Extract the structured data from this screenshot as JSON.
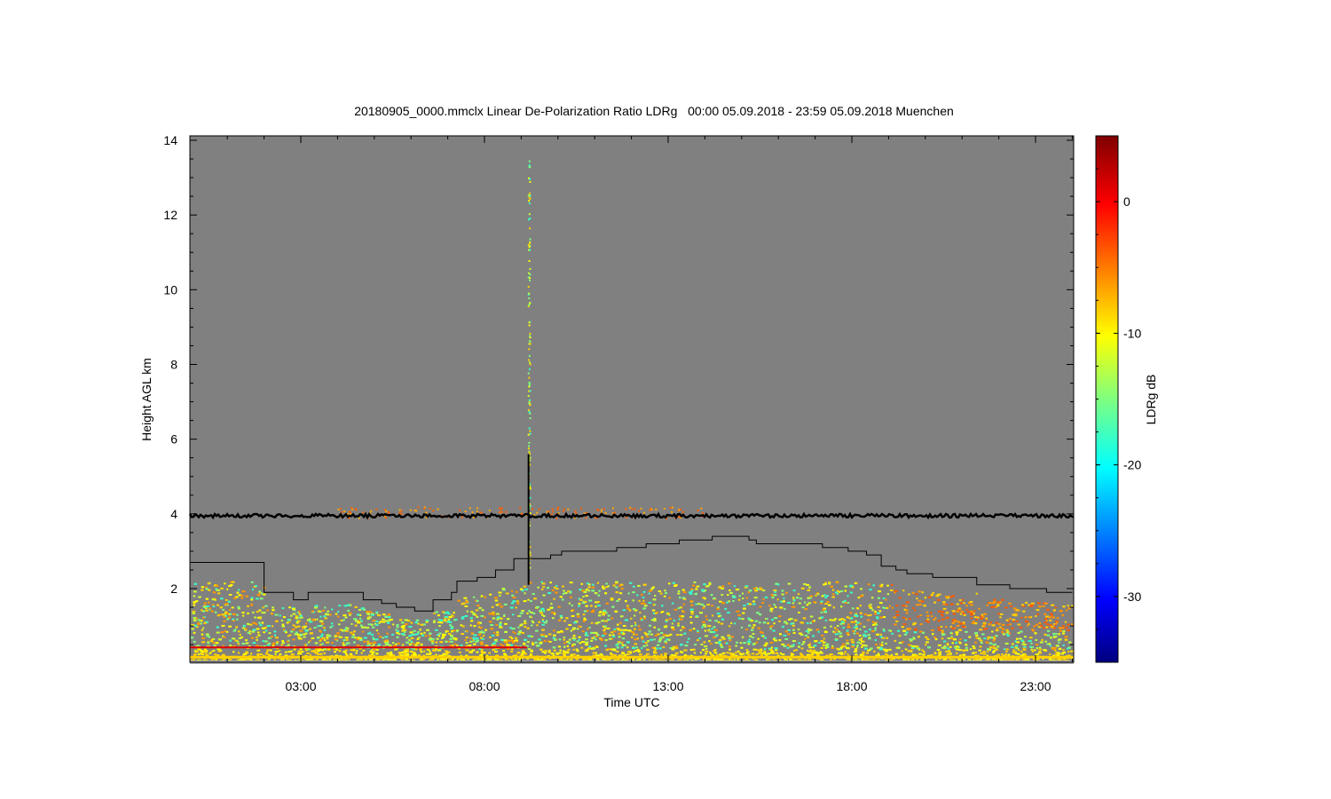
{
  "chart_data": {
    "type": "heatmap",
    "title": "20180905_0000.mmclx Linear De-Polarization Ratio LDRg   00:00 05.09.2018 - 23:59 05.09.2018 Muenchen",
    "xlabel": "Time UTC",
    "ylabel": "Height AGL km",
    "xlim": [
      0,
      24
    ],
    "ylim": [
      0,
      14
    ],
    "x_ticks": [
      {
        "value": 3,
        "label": "03:00"
      },
      {
        "value": 8,
        "label": "08:00"
      },
      {
        "value": 13,
        "label": "13:00"
      },
      {
        "value": 18,
        "label": "18:00"
      },
      {
        "value": 23,
        "label": "23:00"
      }
    ],
    "y_ticks": [
      {
        "value": 2,
        "label": "2"
      },
      {
        "value": 4,
        "label": "4"
      },
      {
        "value": 6,
        "label": "6"
      },
      {
        "value": 8,
        "label": "8"
      },
      {
        "value": 10,
        "label": "10"
      },
      {
        "value": 12,
        "label": "12"
      },
      {
        "value": 14,
        "label": "14"
      }
    ],
    "colorbar": {
      "label": "LDRg dB",
      "range": [
        -35,
        5
      ],
      "ticks": [
        {
          "value": 0,
          "label": "0"
        },
        {
          "value": -10,
          "label": "-10"
        },
        {
          "value": -20,
          "label": "-20"
        },
        {
          "value": -30,
          "label": "-30"
        }
      ],
      "colormap": "jet"
    },
    "background_color": "#808080",
    "noise_line_height_km": 3.95,
    "boundary_layer_top": [
      {
        "x": 0.0,
        "y": 2.7
      },
      {
        "x": 2.0,
        "y": 1.9
      },
      {
        "x": 2.8,
        "y": 1.7
      },
      {
        "x": 3.2,
        "y": 1.9
      },
      {
        "x": 4.7,
        "y": 1.7
      },
      {
        "x": 5.2,
        "y": 1.6
      },
      {
        "x": 5.6,
        "y": 1.5
      },
      {
        "x": 6.1,
        "y": 1.4
      },
      {
        "x": 6.6,
        "y": 1.7
      },
      {
        "x": 7.1,
        "y": 1.9
      },
      {
        "x": 7.25,
        "y": 2.2
      },
      {
        "x": 7.8,
        "y": 2.3
      },
      {
        "x": 8.3,
        "y": 2.5
      },
      {
        "x": 8.8,
        "y": 2.8
      },
      {
        "x": 9.8,
        "y": 2.9
      },
      {
        "x": 10.1,
        "y": 3.0
      },
      {
        "x": 11.6,
        "y": 3.1
      },
      {
        "x": 12.4,
        "y": 3.2
      },
      {
        "x": 13.3,
        "y": 3.3
      },
      {
        "x": 14.2,
        "y": 3.4
      },
      {
        "x": 15.2,
        "y": 3.3
      },
      {
        "x": 15.4,
        "y": 3.2
      },
      {
        "x": 17.2,
        "y": 3.1
      },
      {
        "x": 17.9,
        "y": 3.0
      },
      {
        "x": 18.4,
        "y": 2.9
      },
      {
        "x": 18.8,
        "y": 2.6
      },
      {
        "x": 19.2,
        "y": 2.5
      },
      {
        "x": 19.5,
        "y": 2.4
      },
      {
        "x": 20.2,
        "y": 2.3
      },
      {
        "x": 21.4,
        "y": 2.1
      },
      {
        "x": 22.3,
        "y": 2.0
      },
      {
        "x": 23.3,
        "y": 1.9
      },
      {
        "x": 24.0,
        "y": 1.9
      }
    ],
    "spike": {
      "x": 9.2,
      "y0": 2.1,
      "y1": 5.6
    },
    "grid": false
  }
}
